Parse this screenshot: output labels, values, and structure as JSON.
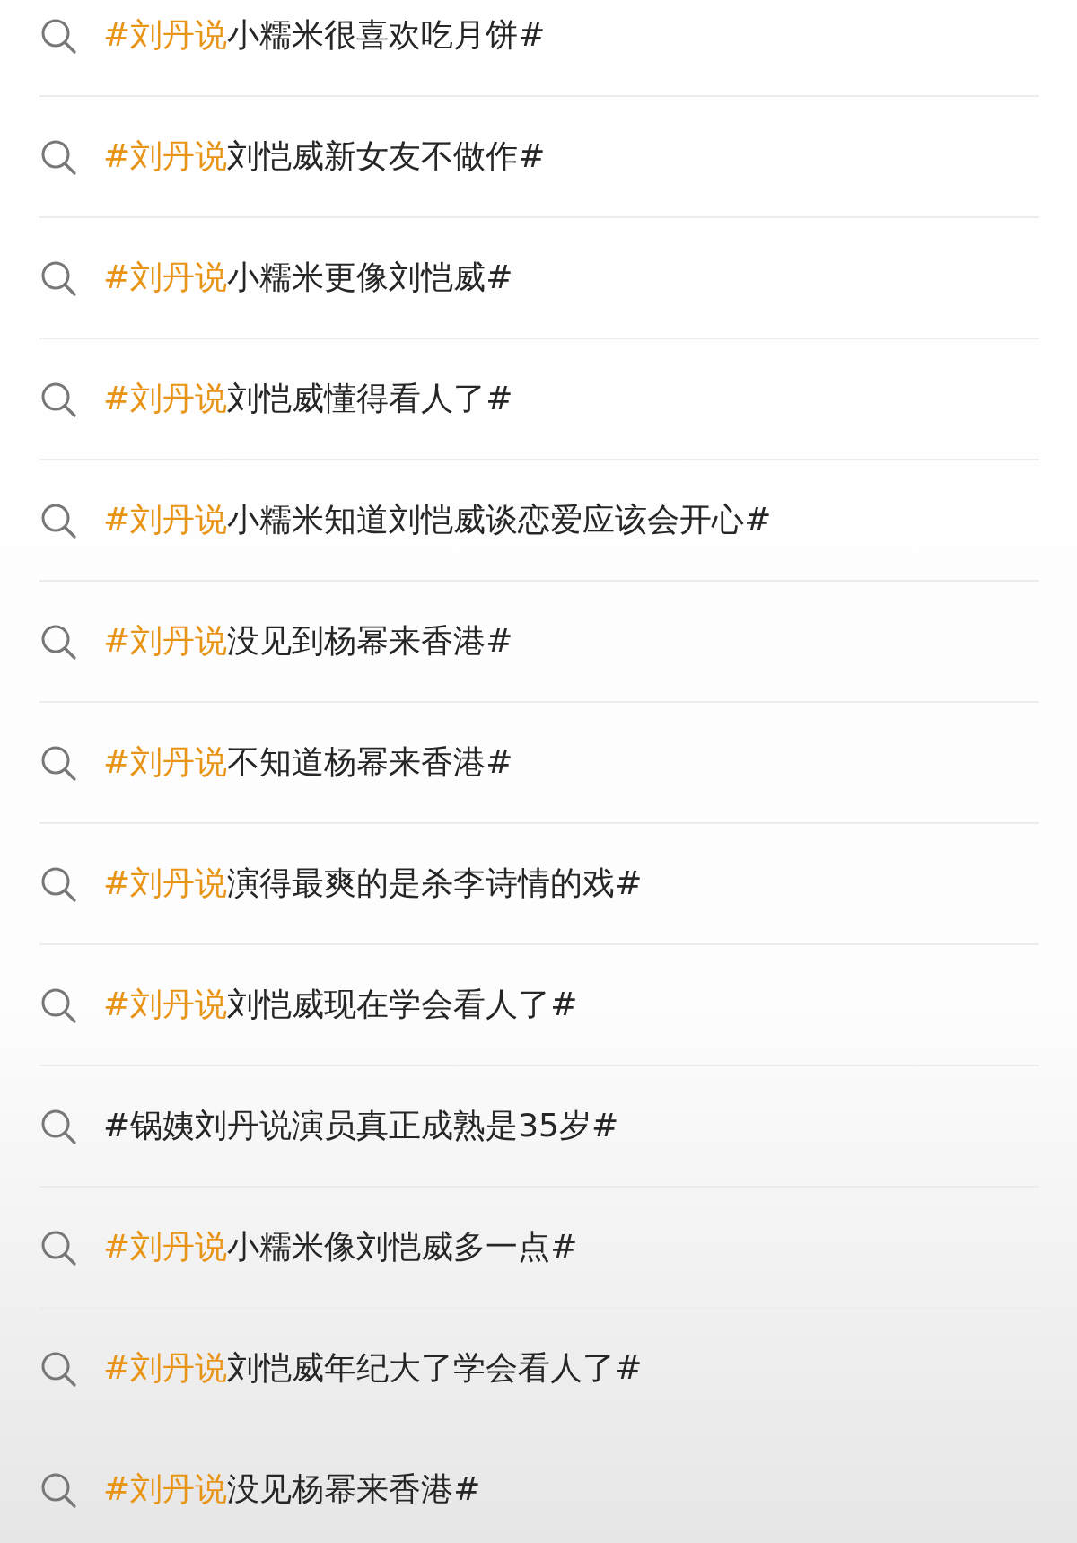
{
  "suggestions": [
    {
      "query": "**#刘丹说**小糯米很喜欢吃月饼#"
    },
    {
      "query": "**#刘丹说**刘恺威新女友不做作#"
    },
    {
      "query": "**#刘丹说**小糯米更像刘恺威#"
    },
    {
      "query": "**#刘丹说**刘恺威懂得看人了#"
    },
    {
      "query": "**#刘丹说**小糯米知道刘恺威谈恋爱应该会开心#"
    },
    {
      "query": "**#刘丹说**没见到杨幂来香港#"
    },
    {
      "query": "**#刘丹说**不知道杨幂来香港#"
    },
    {
      "query": "**#刘丹说**演得最爽的是杀李诗情的戏#"
    },
    {
      "query": "**#刘丹说**刘恺威现在学会看人了#"
    },
    {
      "query": "#锅姨刘丹说演员真正成熟是35岁#"
    },
    {
      "query": "**#刘丹说**小糯米像刘恺威多一点#"
    },
    {
      "query": "**#刘丹说**刘恺威年纪大了学会看人了#"
    },
    {
      "query": "**#刘丹说**没见杨幂来香港#"
    }
  ]
}
